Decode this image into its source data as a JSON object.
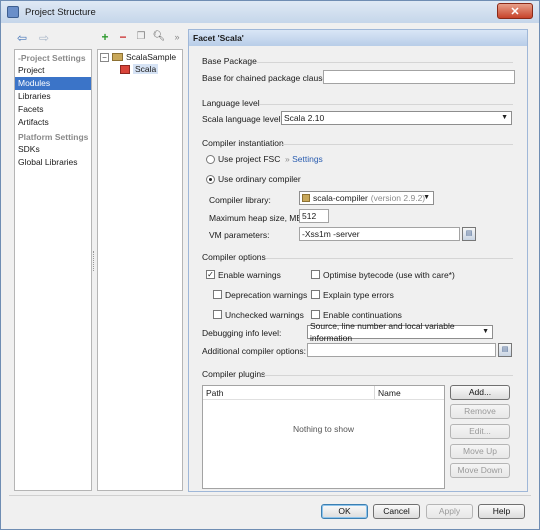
{
  "window": {
    "title": "Project Structure"
  },
  "nav": {
    "project_settings_header": "Project Settings",
    "project_items": [
      "Project",
      "Modules",
      "Libraries",
      "Facets",
      "Artifacts"
    ],
    "platform_settings_header": "Platform Settings",
    "platform_items": [
      "SDKs",
      "Global Libraries"
    ],
    "selected": "Modules"
  },
  "tree": {
    "root": "ScalaSample",
    "child": "Scala"
  },
  "facet": {
    "header": "Facet 'Scala'",
    "base_package": {
      "title": "Base Package",
      "label": "Base for chained package clauses",
      "value": ""
    },
    "language_level": {
      "title": "Language level",
      "label": "Scala language level:",
      "value": "Scala 2.10"
    },
    "compiler_instantiation": {
      "title": "Compiler instantiation",
      "use_fsc_label": "Use project FSC",
      "settings_link": "Settings",
      "use_ordinary_label": "Use ordinary compiler",
      "compiler_library_label": "Compiler library:",
      "compiler_library_value": "scala-compiler",
      "compiler_library_version": "(version 2.9.2)",
      "heap_label": "Maximum heap size, MB:",
      "heap_value": "512",
      "vm_label": "VM parameters:",
      "vm_value": "-Xss1m -server"
    },
    "compiler_options": {
      "title": "Compiler options",
      "enable_warnings": "Enable warnings",
      "optimise_bytecode": "Optimise bytecode (use with care*)",
      "deprecation_warnings": "Deprecation warnings",
      "explain_type_errors": "Explain type errors",
      "unchecked_warnings": "Unchecked warnings",
      "enable_continuations": "Enable continuations",
      "debug_label": "Debugging info level:",
      "debug_value": "Source, line number and local variable information",
      "additional_label": "Additional compiler options:",
      "additional_value": ""
    },
    "compiler_plugins": {
      "title": "Compiler plugins",
      "col_path": "Path",
      "col_name": "Name",
      "empty": "Nothing to show",
      "add": "Add...",
      "remove": "Remove",
      "edit": "Edit...",
      "move_up": "Move Up",
      "move_down": "Move Down"
    }
  },
  "footer": {
    "ok": "OK",
    "cancel": "Cancel",
    "apply": "Apply",
    "help": "Help"
  }
}
